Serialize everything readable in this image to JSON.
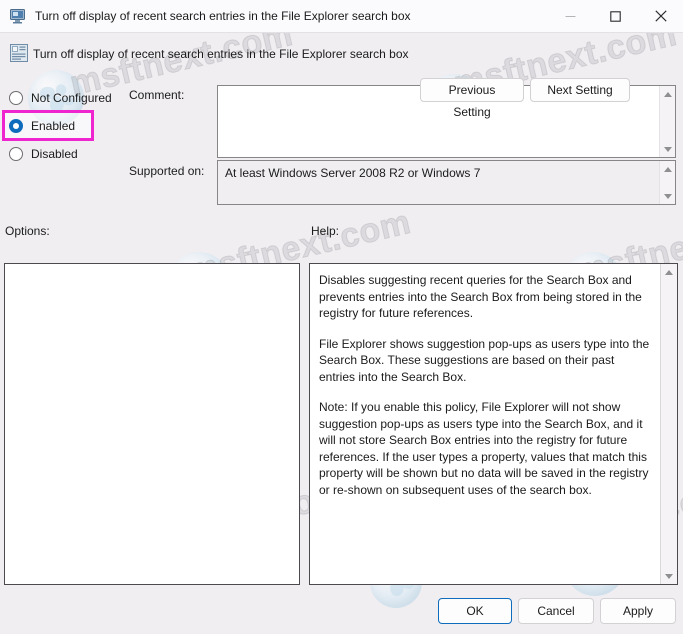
{
  "window": {
    "title": "Turn off display of recent search entries in the File Explorer search box",
    "title_icon": "computer-monitor-icon",
    "controls": {
      "minimize": "minimize-icon",
      "maximize": "maximize-icon",
      "close": "close-icon"
    }
  },
  "header": {
    "policy_icon": "group-policy-setting-icon",
    "policy_title": "Turn off display of recent search entries in the File Explorer search box",
    "previous_setting_label": "Previous Setting",
    "next_setting_label": "Next Setting"
  },
  "state": {
    "options": [
      {
        "id": "not-configured",
        "label": "Not Configured",
        "selected": false
      },
      {
        "id": "enabled",
        "label": "Enabled",
        "selected": true
      },
      {
        "id": "disabled",
        "label": "Disabled",
        "selected": false
      }
    ],
    "highlight_color": "#ef26cf",
    "accent_color": "#0f6cbd"
  },
  "fields": {
    "comment_label": "Comment:",
    "comment_value": "",
    "supported_label": "Supported on:",
    "supported_value": "At least Windows Server 2008 R2 or Windows 7"
  },
  "panels": {
    "options_label": "Options:",
    "options_content": "",
    "help_label": "Help:",
    "help_paragraphs": [
      "Disables suggesting recent queries for the Search Box and prevents entries into the Search Box from being stored in the registry for future references.",
      "File Explorer shows suggestion pop-ups as users type into the Search Box.  These suggestions are based on their past entries into the Search Box.",
      "Note: If you enable this policy, File Explorer will not show suggestion pop-ups as users type into the Search Box, and it will not store Search Box entries into the registry for future references.  If the user types a property, values that match this property will be shown but no data will be saved in the registry or re-shown on subsequent uses of the search box."
    ]
  },
  "footer": {
    "ok_label": "OK",
    "cancel_label": "Cancel",
    "apply_label": "Apply"
  },
  "watermark": {
    "text": "msftnext.com"
  }
}
